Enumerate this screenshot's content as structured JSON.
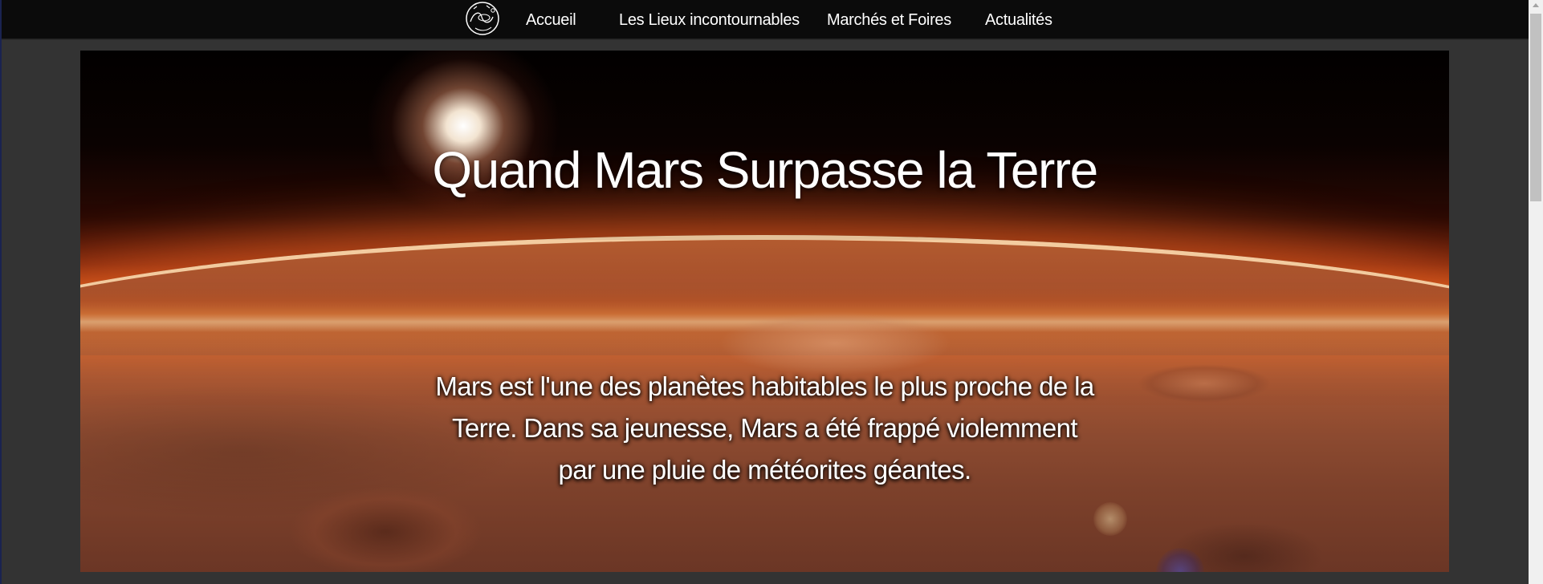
{
  "nav": {
    "logo_icon": "circular-sketch-logo-icon",
    "items": [
      {
        "label": "Accueil"
      },
      {
        "label": "Les Lieux incontournables"
      },
      {
        "label": "Marchés et Foires"
      },
      {
        "label": "Actualités"
      }
    ]
  },
  "hero": {
    "title": "Quand Mars Surpasse la Terre",
    "text": "Mars est l'une des planètes habitables le plus proche de la Terre. Dans sa jeunesse, Mars a été frappé violemment par une pluie de météorites géantes.",
    "image": "mars-surface-horizon-image"
  },
  "colors": {
    "nav_background": "#0b0b0b",
    "page_background": "#333333",
    "text": "#ffffff"
  }
}
